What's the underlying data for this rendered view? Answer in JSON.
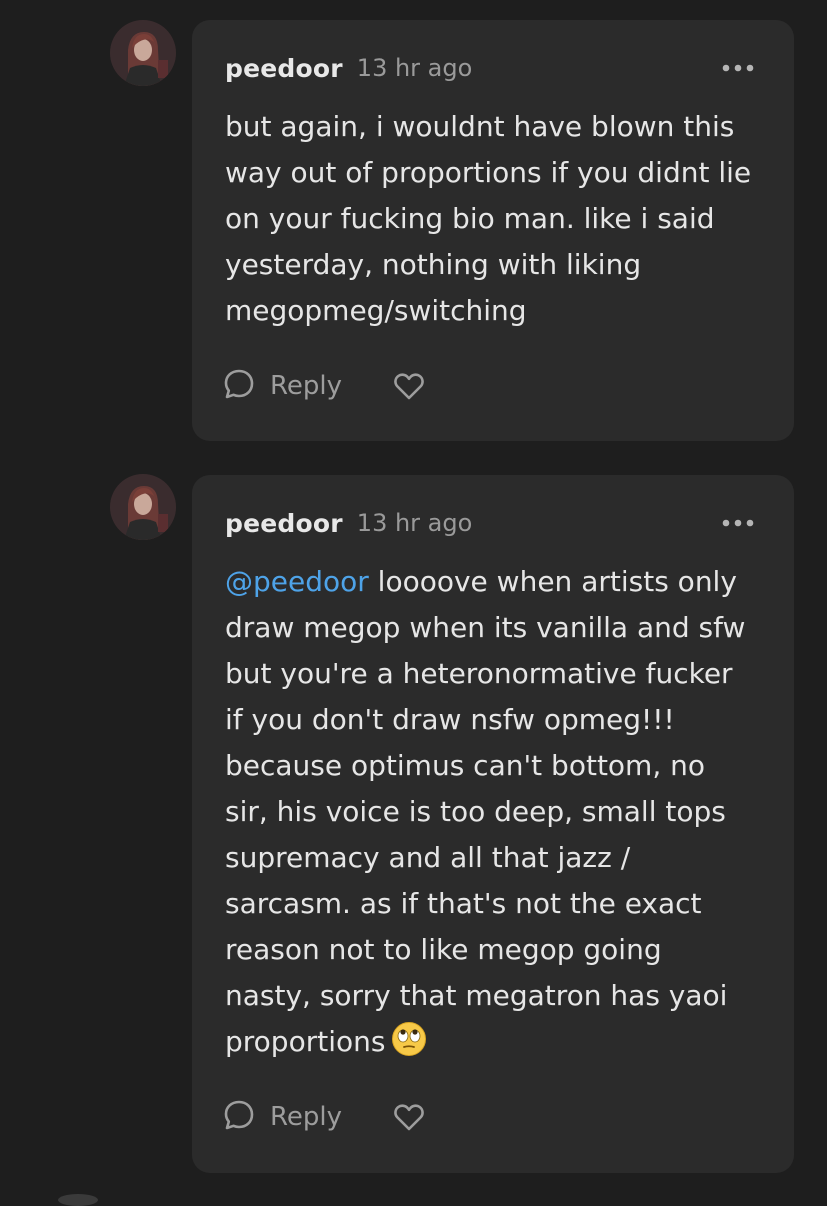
{
  "comments": [
    {
      "username": "peedoor",
      "time": "13 hr ago",
      "mention": "",
      "text": "but again, i wouldnt have blown this\nway out of proportions if you didnt lie\non your fucking bio man. like i said\nyesterday, nothing with liking\nmegopmeg/switching",
      "reply_label": "Reply",
      "more_icon": "more-options-icon",
      "like_icon": "heart-icon"
    },
    {
      "username": "peedoor",
      "time": "13 hr ago",
      "mention": "@peedoor",
      "text": " loooove when artists only\ndraw megop when its vanilla and sfw\nbut you're a heteronormative fucker\nif you don't draw nsfw opmeg!!!\nbecause optimus can't bottom, no\nsir, his voice is too deep, small tops\nsupremacy and all that jazz /\nsarcasm. as if that's not the exact\nreason not to like megop going\nnasty, sorry that megatron has yaoi\nproportions",
      "emoji": "eye-roll-emoji",
      "reply_label": "Reply",
      "more_icon": "more-options-icon",
      "like_icon": "heart-icon"
    }
  ],
  "colors": {
    "background": "#1e1e1e",
    "card": "#2b2b2b",
    "mention": "#4ea3e8",
    "muted": "#9a9a9a"
  }
}
